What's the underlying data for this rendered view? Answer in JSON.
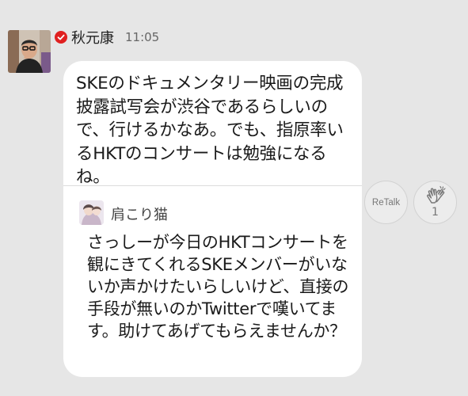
{
  "post": {
    "author": "秋元康",
    "time": "11:05",
    "text": "SKEのドキュメンタリー映画の完成披露試写会が渋谷であるらしいので、行けるかなあ。でも、指原率いるHKTのコンサートは勉強になるね。"
  },
  "quote": {
    "author": "肩こり猫",
    "text": "さっしーが今日のHKTコンサートを観にきてくれるSKEメンバーがいないか声かけたいらしいけど、直接の手段が無いのかTwitterで嘆いてます。助けてあげてもらえませんか？"
  },
  "actions": {
    "retalk_label": "ReTalk",
    "clap_count": "1"
  },
  "icons": {
    "verified": "verified-check-icon",
    "clap": "clap-icon"
  },
  "colors": {
    "background": "#e6e6e6",
    "card": "#ffffff",
    "verified_badge": "#e02020"
  }
}
